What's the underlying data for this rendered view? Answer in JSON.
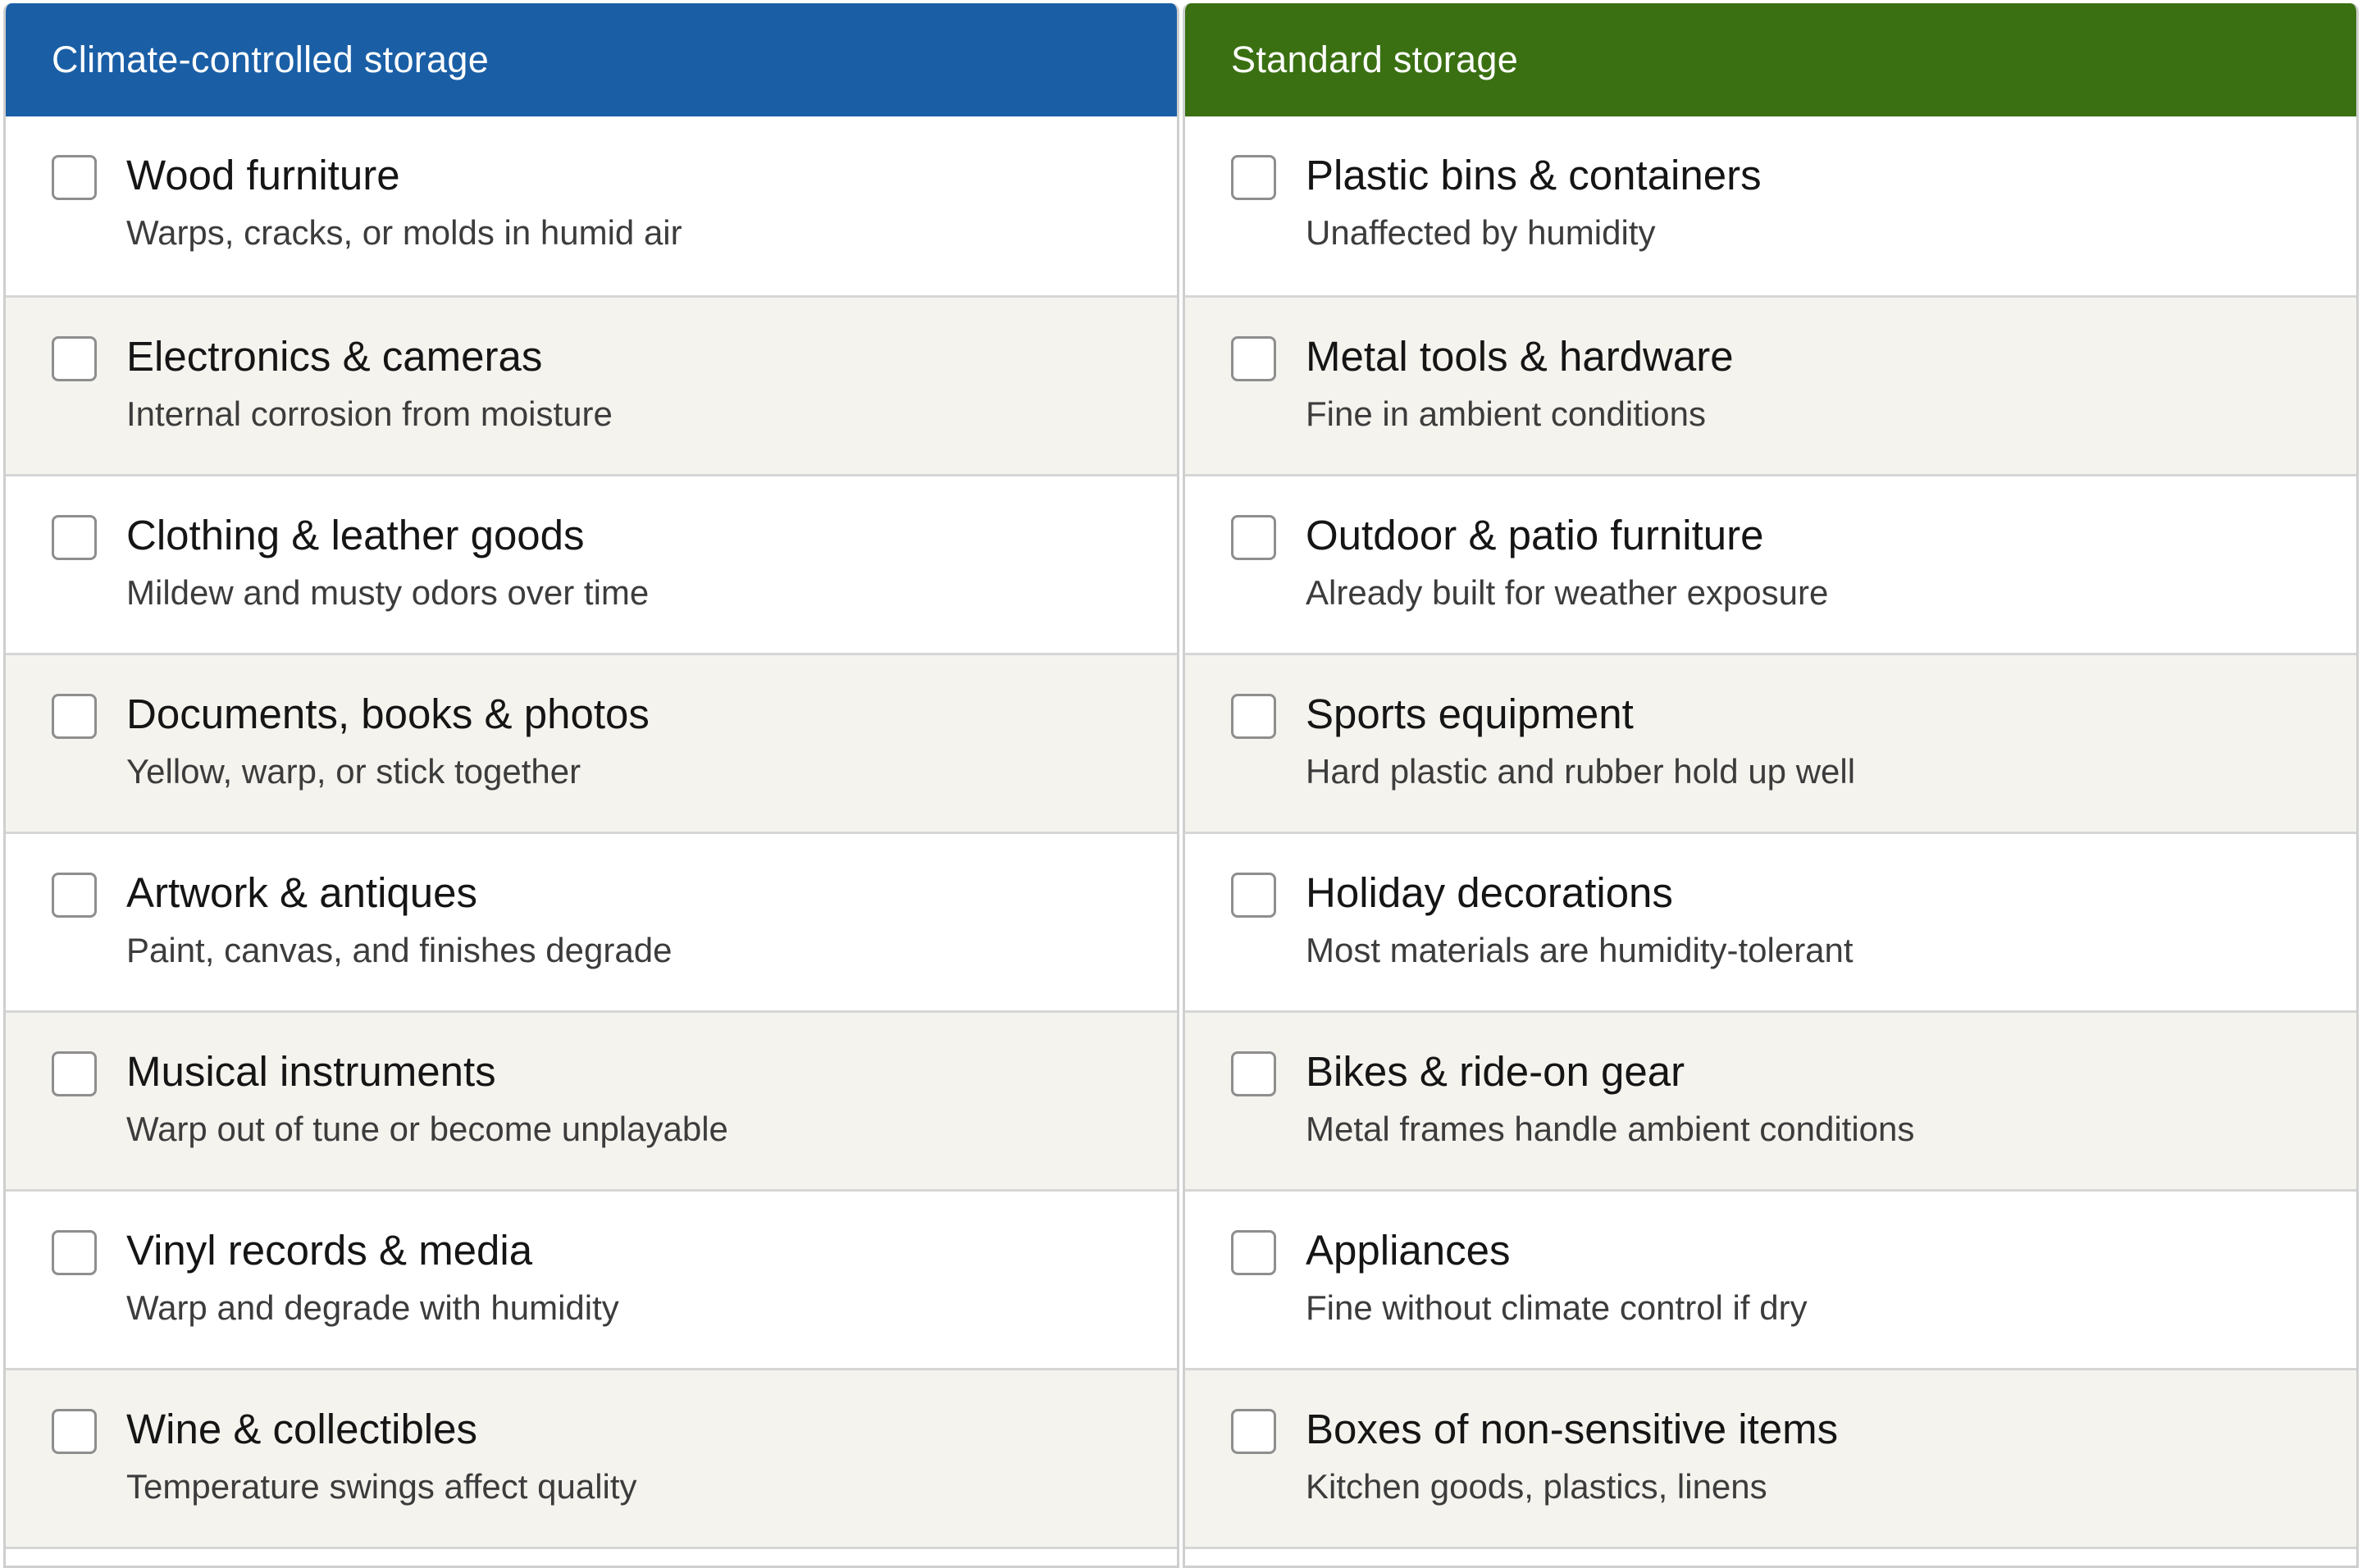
{
  "columns": [
    {
      "header": "Climate-controlled storage",
      "accent": "#1a5fa6",
      "items": [
        {
          "title": "Wood furniture",
          "desc": "Warps, cracks, or molds in humid air",
          "checked": false
        },
        {
          "title": "Electronics & cameras",
          "desc": "Internal corrosion from moisture",
          "checked": false
        },
        {
          "title": "Clothing & leather goods",
          "desc": "Mildew and musty odors over time",
          "checked": false
        },
        {
          "title": "Documents, books & photos",
          "desc": "Yellow, warp, or stick together",
          "checked": false
        },
        {
          "title": "Artwork & antiques",
          "desc": "Paint, canvas, and finishes degrade",
          "checked": false
        },
        {
          "title": "Musical instruments",
          "desc": "Warp out of tune or become unplayable",
          "checked": false
        },
        {
          "title": "Vinyl records & media",
          "desc": "Warp and degrade with humidity",
          "checked": false
        },
        {
          "title": "Wine & collectibles",
          "desc": "Temperature swings affect quality",
          "checked": false
        }
      ]
    },
    {
      "header": "Standard storage",
      "accent": "#3a7012",
      "items": [
        {
          "title": "Plastic bins & containers",
          "desc": "Unaffected by humidity",
          "checked": false
        },
        {
          "title": "Metal tools & hardware",
          "desc": "Fine in ambient conditions",
          "checked": false
        },
        {
          "title": "Outdoor & patio furniture",
          "desc": "Already built for weather exposure",
          "checked": false
        },
        {
          "title": "Sports equipment",
          "desc": "Hard plastic and rubber hold up well",
          "checked": false
        },
        {
          "title": "Holiday decorations",
          "desc": "Most materials are humidity-tolerant",
          "checked": false
        },
        {
          "title": "Bikes & ride-on gear",
          "desc": "Metal frames handle ambient conditions",
          "checked": false
        },
        {
          "title": "Appliances",
          "desc": "Fine without climate control if dry",
          "checked": false
        },
        {
          "title": "Boxes of non-sensitive items",
          "desc": "Kitchen goods, plastics, linens",
          "checked": false
        }
      ]
    }
  ],
  "colors": {
    "row_alt_background": "#f4f3ee",
    "divider": "#d6d6d6",
    "checkbox_border": "#8e8e8e"
  }
}
